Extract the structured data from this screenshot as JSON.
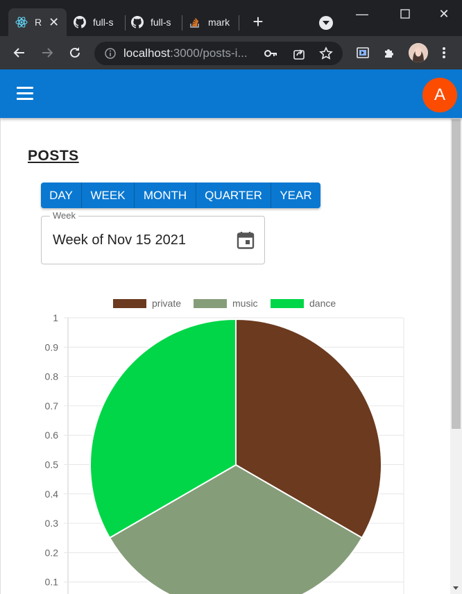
{
  "browser": {
    "tabs": [
      {
        "label": "R",
        "active": true
      },
      {
        "label": "full-s"
      },
      {
        "label": "full-s"
      },
      {
        "label": "mark"
      }
    ],
    "url_host": "localhost",
    "url_rest": ":3000/posts-i..."
  },
  "app": {
    "avatar_letter": "A",
    "page_title": "POSTS",
    "range_buttons": [
      "DAY",
      "WEEK",
      "MONTH",
      "QUARTER",
      "YEAR"
    ],
    "date_field": {
      "label": "Week",
      "value": "Week of Nov 15 2021"
    }
  },
  "colors": {
    "appbar": "#0a78d1",
    "avatar": "#fc4c02",
    "private": "#6b3a1f",
    "music": "#869d7a",
    "dance": "#00d647"
  },
  "chart_data": {
    "type": "pie",
    "legend": [
      "private",
      "music",
      "dance"
    ],
    "values": [
      1,
      1,
      1
    ],
    "colors": [
      "#6b3a1f",
      "#869d7a",
      "#00d647"
    ],
    "y_ticks": [
      "1",
      "0.9",
      "0.8",
      "0.7",
      "0.6",
      "0.5",
      "0.4",
      "0.3",
      "0.2",
      "0.1"
    ],
    "ylim": [
      0,
      1
    ],
    "grid": true,
    "legend_position": "top"
  }
}
